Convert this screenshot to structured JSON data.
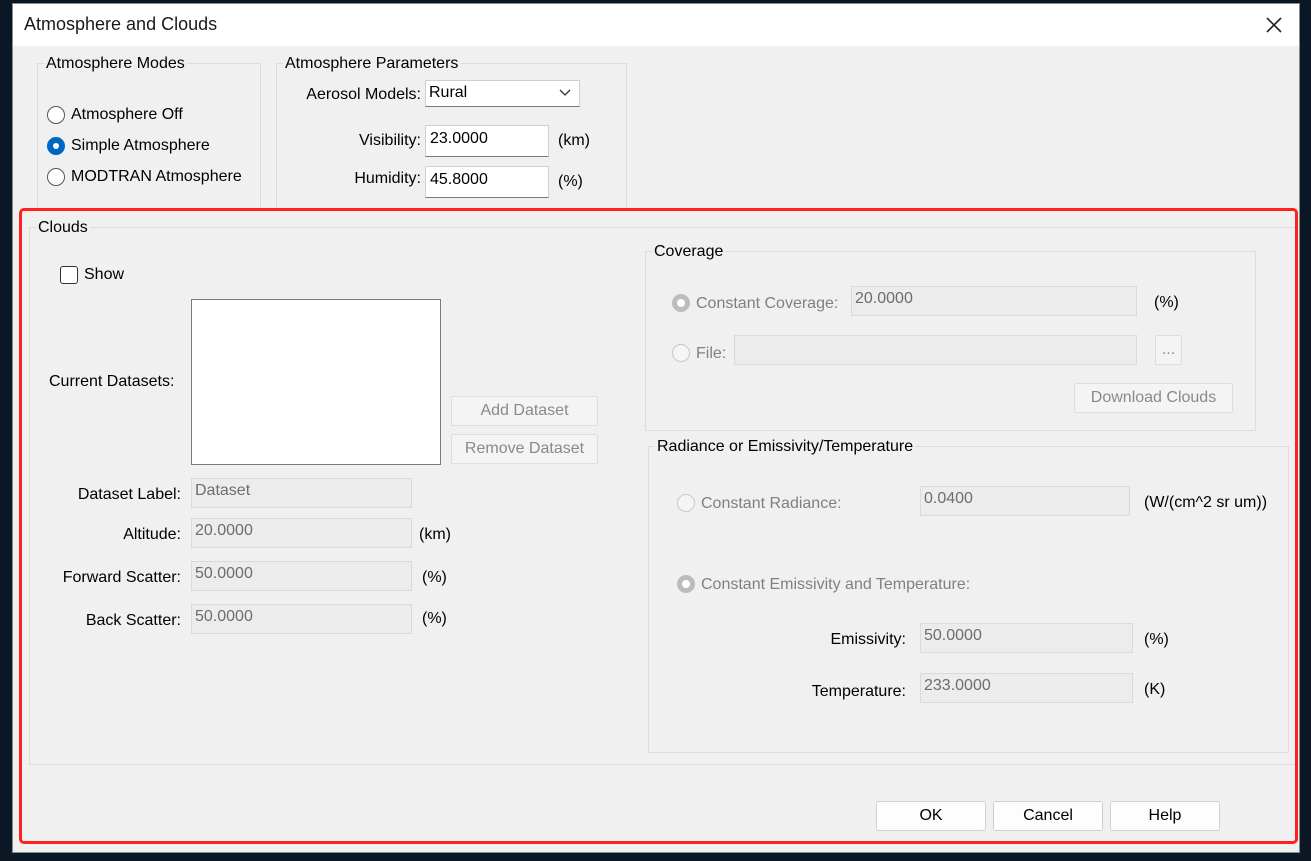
{
  "dialog": {
    "title": "Atmosphere and Clouds"
  },
  "atmosphere_modes": {
    "title": "Atmosphere Modes",
    "options": [
      {
        "label": "Atmosphere Off",
        "selected": false
      },
      {
        "label": "Simple Atmosphere",
        "selected": true
      },
      {
        "label": "MODTRAN Atmosphere",
        "selected": false
      }
    ]
  },
  "atmosphere_params": {
    "title": "Atmosphere Parameters",
    "aerosol_label": "Aerosol Models:",
    "aerosol_value": "Rural",
    "visibility_label": "Visibility:",
    "visibility_value": "23.0000",
    "visibility_unit": "(km)",
    "humidity_label": "Humidity:",
    "humidity_value": "45.8000",
    "humidity_unit": "(%)"
  },
  "clouds": {
    "title": "Clouds",
    "show_label": "Show",
    "show_checked": false,
    "datasets_label": "Current Datasets:",
    "add_dataset": "Add Dataset",
    "remove_dataset": "Remove Dataset",
    "dataset_label_label": "Dataset Label:",
    "dataset_label_value": "Dataset",
    "altitude_label": "Altitude:",
    "altitude_value": "20.0000",
    "altitude_unit": "(km)",
    "forward_scatter_label": "Forward Scatter:",
    "forward_scatter_value": "50.0000",
    "forward_scatter_unit": "(%)",
    "back_scatter_label": "Back Scatter:",
    "back_scatter_value": "50.0000",
    "back_scatter_unit": "(%)"
  },
  "coverage": {
    "title": "Coverage",
    "constant_label": "Constant Coverage:",
    "constant_value": "20.0000",
    "constant_unit": "(%)",
    "file_label": "File:",
    "file_value": "",
    "browse_label": "...",
    "download_label": "Download Clouds"
  },
  "radiance": {
    "title": "Radiance or Emissivity/Temperature",
    "constant_radiance_label": "Constant Radiance:",
    "constant_radiance_value": "0.0400",
    "constant_radiance_unit": "(W/(cm^2 sr um))",
    "emissivity_temp_label": "Constant Emissivity and Temperature:",
    "emissivity_label": "Emissivity:",
    "emissivity_value": "50.0000",
    "emissivity_unit": "(%)",
    "temperature_label": "Temperature:",
    "temperature_value": "233.0000",
    "temperature_unit": "(K)"
  },
  "buttons": {
    "ok": "OK",
    "cancel": "Cancel",
    "help": "Help"
  },
  "colors": {
    "accent": "#0067c0",
    "highlight": "#ff2020",
    "dialog_bg": "#f0f0f0"
  }
}
